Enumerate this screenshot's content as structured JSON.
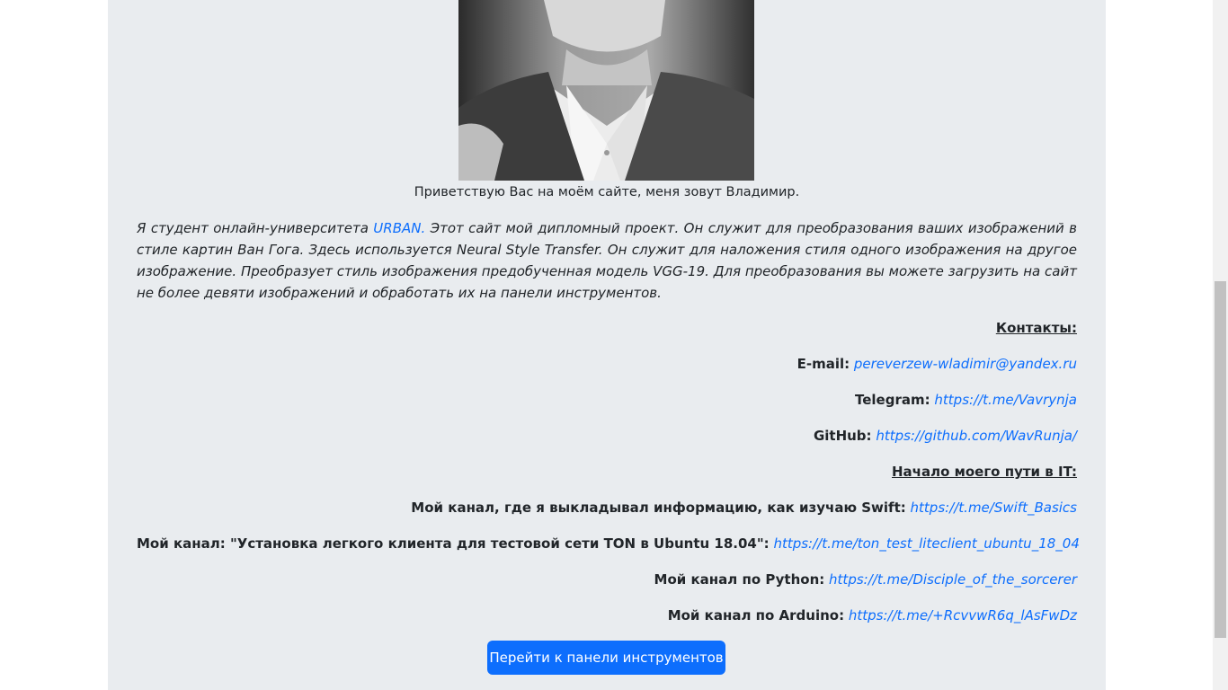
{
  "greeting": "Приветствую Вас на моём сайте, меня зовут Владимир.",
  "intro": {
    "before_link": "Я студент онлайн-университета ",
    "link_text": "URBAN.",
    "after_link": " Этот сайт мой дипломный проект. Он служит для преобразования ваших изображений в стиле картин Ван Гога. Здесь используется Neural Style Transfer. Он служит для наложения стиля одного изображения на другое изображение. Преобразует стиль изображения предобученная модель VGG-19. Для преобразования вы можете загрузить на сайт не более девяти изображений и обработать их на панели инструментов."
  },
  "contacts": {
    "heading": "Контакты:",
    "email_label": "E-mail:",
    "email_value": "pereverzew-wladimir@yandex.ru",
    "telegram_label": "Telegram:",
    "telegram_value": "https://t.me/Vavrynja",
    "github_label": "GitHub:",
    "github_value": "https://github.com/WavRunja/"
  },
  "journey": {
    "heading": "Начало моего пути в IT:",
    "swift_label": "Мой канал, где я выкладывал информацию, как изучаю Swift:",
    "swift_value": "https://t.me/Swift_Basics",
    "ton_label": "Мой канал: \"Установка легкого клиента для тестовой сети TON в Ubuntu 18.04\":",
    "ton_value": "https://t.me/ton_test_liteclient_ubuntu_18_04",
    "python_label": "Мой канал по Python:",
    "python_value": "https://t.me/Disciple_of_the_sorcerer",
    "arduino_label": "Мой канал по Arduino:",
    "arduino_value": "https://t.me/+RcvvwR6q_lAsFwDz"
  },
  "button_label": "Перейти к панели инструментов",
  "colors": {
    "panel_bg": "#e9ecef",
    "link": "#0d6efd",
    "button_bg": "#0d6efd",
    "text": "#212529"
  }
}
